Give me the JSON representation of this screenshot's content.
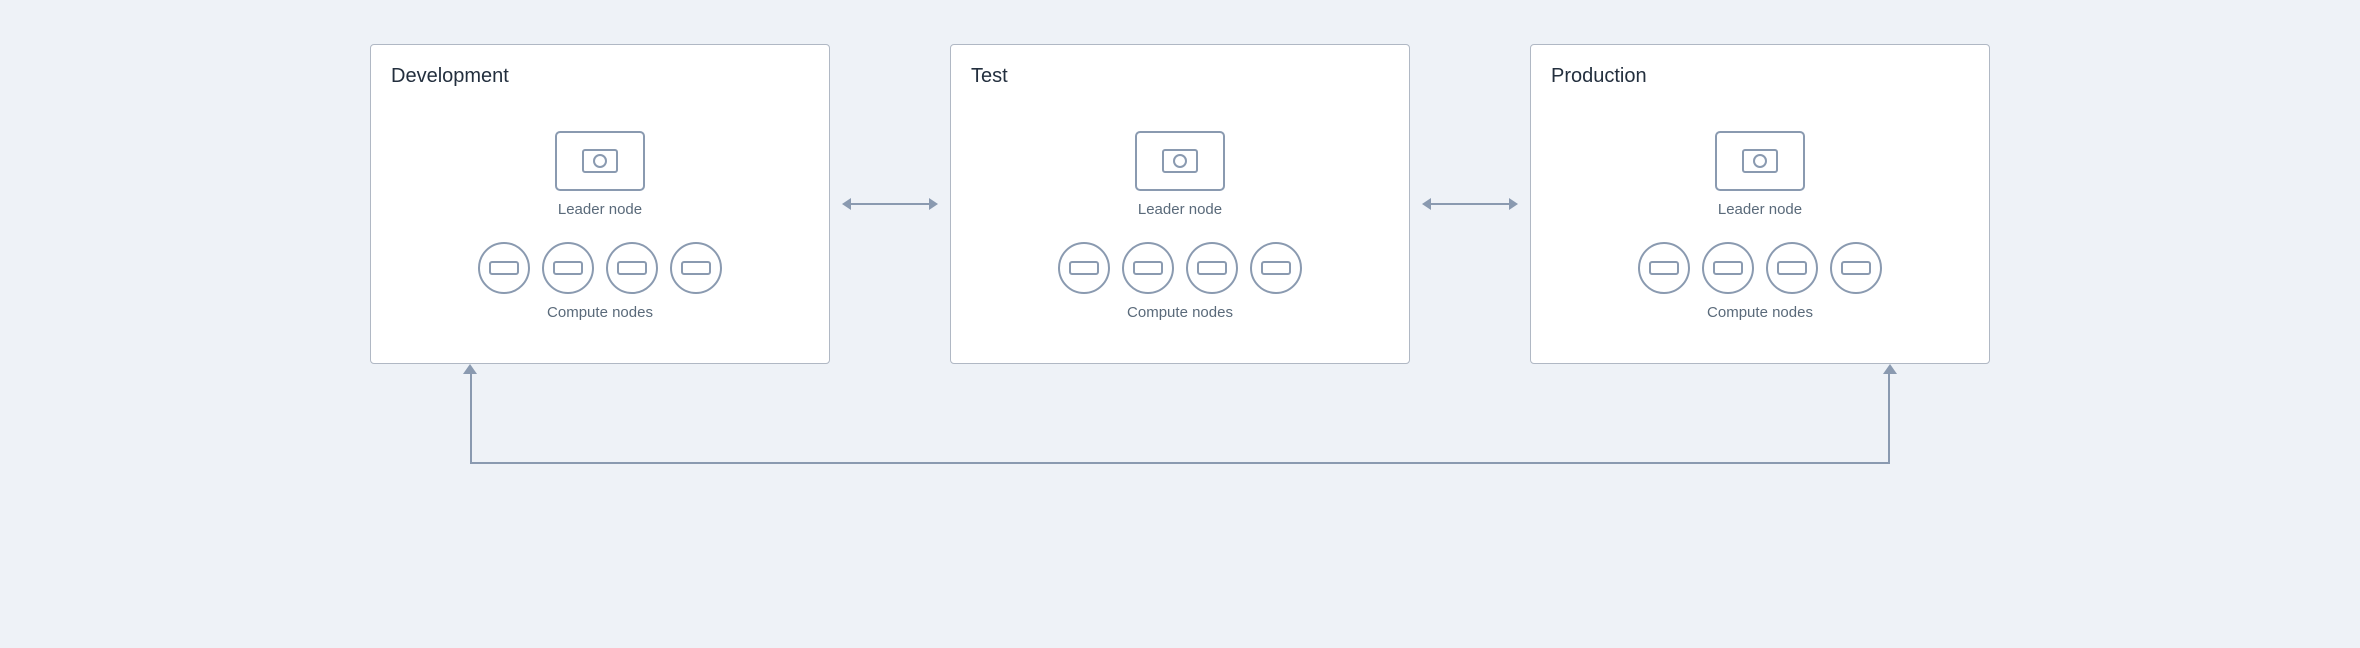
{
  "environments": [
    {
      "id": "development",
      "title": "Development",
      "leaderLabel": "Leader node",
      "computeLabel": "Compute nodes",
      "computeCount": 4
    },
    {
      "id": "test",
      "title": "Test",
      "leaderLabel": "Leader node",
      "computeLabel": "Compute nodes",
      "computeCount": 4
    },
    {
      "id": "production",
      "title": "Production",
      "leaderLabel": "Leader node",
      "computeLabel": "Compute nodes",
      "computeCount": 4
    }
  ],
  "arrows": {
    "horizontal": "↔",
    "bottom_u": "bottom-u-shape"
  }
}
